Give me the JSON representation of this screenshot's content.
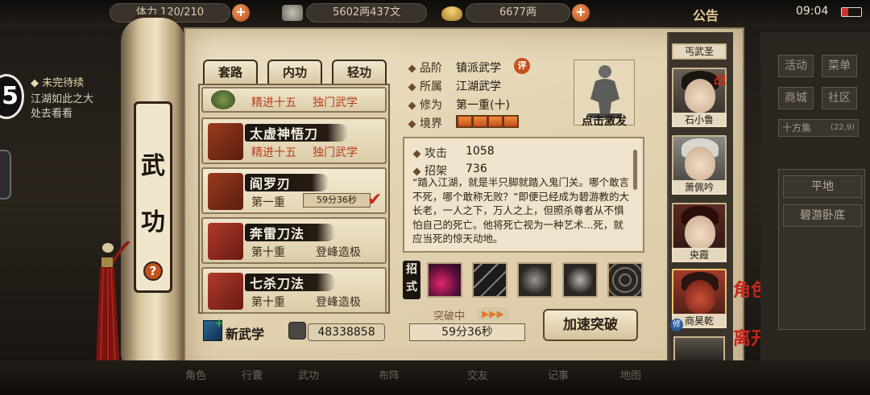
{
  "topbar": {
    "stamina": "体力 120/210",
    "silver": "5602两437文",
    "gold": "6677两",
    "announcement": "公告",
    "time": "09:04"
  },
  "left_quest": {
    "status": "◆ 未完待续",
    "line1": "江湖如此之大",
    "line2": "处去看看",
    "badge_num": "5"
  },
  "scroll_title": [
    "武",
    "功"
  ],
  "scroll_help": "?",
  "tabs": [
    "套路",
    "内功",
    "轻功"
  ],
  "skills_list": [
    {
      "name": "",
      "sub_left": "精进十五",
      "sub_right": "独门武学"
    },
    {
      "name": "太虚神悟刀",
      "sub_left": "精进十五",
      "sub_right": "独门武学"
    },
    {
      "name": "阎罗刃",
      "sub_left": "第一重",
      "timer": "59分36秒"
    },
    {
      "name": "奔雷刀法",
      "sub_left": "第十重",
      "sub_right": "登峰造极"
    },
    {
      "name": "七杀刀法",
      "sub_left": "第十重",
      "sub_right": "登峰造极"
    }
  ],
  "new_skill": "新武学",
  "points": "48338858",
  "info": {
    "grade_label": "品阶",
    "grade_value": "镇派武学",
    "eval": "评",
    "belong_label": "所属",
    "belong_value": "江湖武学",
    "level_label": "修为",
    "level_value": "第一重(十)",
    "realm_label": "境界"
  },
  "figure_label": "点击激发",
  "desc": {
    "attack_label": "攻击",
    "attack_value": "1058",
    "parry_label": "招架",
    "parry_value": "736",
    "text": "“踏入江湖，就是半只脚就踏入鬼门关。哪个敢言不死，哪个敢称无败？”即便已经成为碧游教的大长老，一人之下，万人之上，但照杀尊者从不惧怕自己的死亡。他将死亡视为一种艺术...死，就应当死的惊天动地。"
  },
  "moves_label": [
    "招",
    "式"
  ],
  "breakthrough": {
    "label": "突破中",
    "time": "59分36秒",
    "button": "加速突破"
  },
  "characters": [
    {
      "name": "丐武圣"
    },
    {
      "name": "石小鲁",
      "tag": "战"
    },
    {
      "name": "萧佩吟"
    },
    {
      "name": "央霞"
    },
    {
      "name": "商昊乾",
      "tag": "修"
    }
  ],
  "char_side_labels": {
    "role": "角色",
    "leave": "离开"
  },
  "right_panel": {
    "buttons": [
      "活动",
      "菜单",
      "商城",
      "社区"
    ],
    "location": "十方集",
    "location_code": "(22,9)",
    "terrain": "平地",
    "room": "碧游卧底"
  },
  "bottom_bar": [
    "角色",
    "行囊",
    "武功",
    "布阵",
    "交友",
    "记事",
    "地图"
  ],
  "colors": {
    "accent_red": "#c8261a",
    "paper": "#e3d4b3",
    "ink": "#1a1510",
    "orange": "#e07a30"
  }
}
